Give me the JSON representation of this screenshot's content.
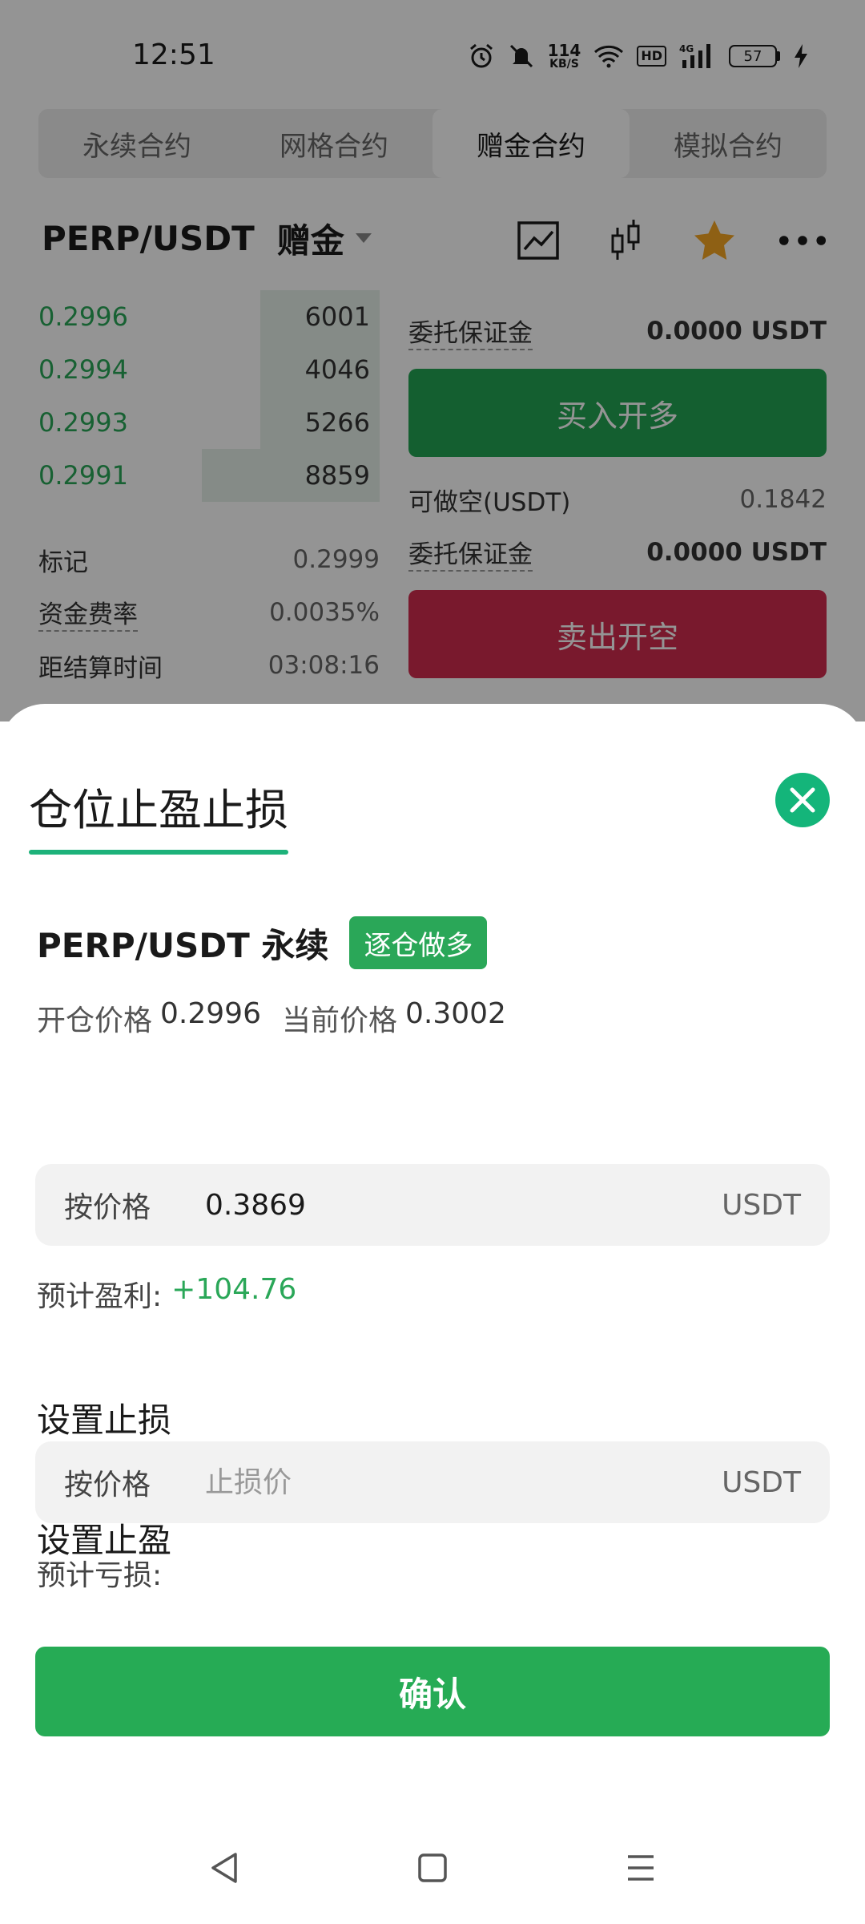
{
  "status_bar": {
    "time": "12:51",
    "net_speed_value": "114",
    "net_speed_unit": "KB/S",
    "hd": "HD",
    "signal": "4G",
    "battery": "57"
  },
  "tabs": [
    {
      "label": "永续合约",
      "active": false
    },
    {
      "label": "网格合约",
      "active": false
    },
    {
      "label": "赠金合约",
      "active": true
    },
    {
      "label": "模拟合约",
      "active": false
    }
  ],
  "pair_header": {
    "pair": "PERP/USDT",
    "tag": "赠金",
    "icons": [
      "line-chart-icon",
      "candlestick-icon",
      "star-icon",
      "more-icon"
    ]
  },
  "orderbook": {
    "rows": [
      {
        "price": "0.2996",
        "qty": "6001",
        "depth": 0.35
      },
      {
        "price": "0.2994",
        "qty": "4046",
        "depth": 0.35
      },
      {
        "price": "0.2993",
        "qty": "5266",
        "depth": 0.35
      },
      {
        "price": "0.2991",
        "qty": "8859",
        "depth": 0.52
      }
    ]
  },
  "stats": {
    "mark_label": "标记",
    "mark_value": "0.2999",
    "funding_label": "资金费率",
    "funding_value": "0.0035%",
    "settle_label": "距结算时间",
    "settle_value": "03:08:16"
  },
  "trade_panel": {
    "margin_label_1": "委托保证金",
    "margin_value_1": "0.0000 USDT",
    "buy_label": "买入开多",
    "short_label": "可做空(USDT)",
    "short_value": "0.1842",
    "margin_label_2": "委托保证金",
    "margin_value_2": "0.0000 USDT",
    "sell_label": "卖出开空"
  },
  "sheet": {
    "title": "仓位止盈止损",
    "symbol": "PERP/USDT 永续",
    "badge": "逐仓做多",
    "open_price_label": "开仓价格",
    "open_price": "0.2996",
    "current_price_label": "当前价格",
    "current_price": "0.3002",
    "take_profit": {
      "section_label": "设置止盈",
      "input_label": "按价格",
      "value": "0.3869",
      "placeholder": "",
      "unit": "USDT",
      "est_label": "预计盈利:",
      "est_value": "+104.76"
    },
    "stop_loss": {
      "section_label": "设置止损",
      "input_label": "按价格",
      "value": "",
      "placeholder": "止损价",
      "unit": "USDT",
      "est_label": "预计亏损:",
      "est_value": ""
    },
    "confirm_label": "确认"
  },
  "colors": {
    "accent_green": "#26ab55",
    "buy_green": "#24a453",
    "sell_red": "#d12b4f",
    "close_green": "#14b57a"
  }
}
